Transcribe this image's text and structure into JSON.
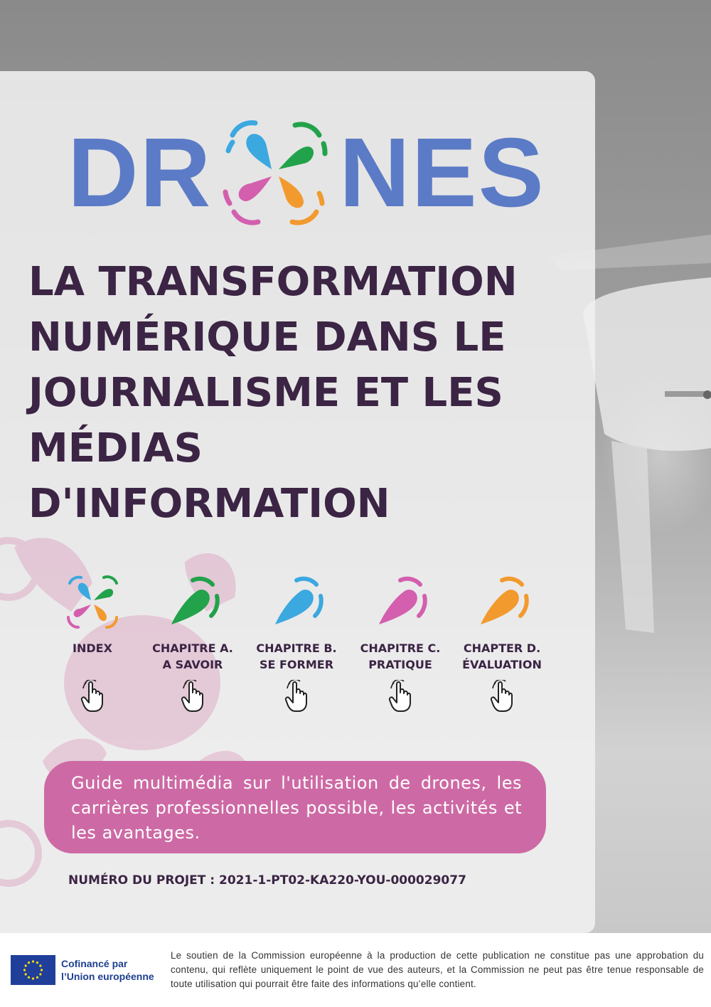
{
  "logo": {
    "left_text": "DR",
    "right_text": "NES",
    "colors": {
      "text": "#5b7bc6",
      "blue": "#3ba8e0",
      "green": "#22a24a",
      "pink": "#d35fae",
      "orange": "#f29a2e"
    }
  },
  "title_lines": [
    "LA TRANSFORMATION",
    "NUMÉRIQUE DANS LE",
    "JOURNALISME ET LES",
    "MÉDIAS",
    "D'INFORMATION"
  ],
  "nav": [
    {
      "icon": "drones-logo-icon",
      "line1": "INDEX",
      "line2": ""
    },
    {
      "icon": "green-drone-icon",
      "color": "#22a24a",
      "line1": "CHAPITRE A.",
      "line2": "A SAVOIR"
    },
    {
      "icon": "blue-drone-icon",
      "color": "#3ba8e0",
      "line1": "CHAPITRE B.",
      "line2": "SE FORMER"
    },
    {
      "icon": "pink-drone-icon",
      "color": "#d35fae",
      "line1": "CHAPITRE C.",
      "line2": "PRATIQUE"
    },
    {
      "icon": "orange-drone-icon",
      "color": "#f29a2e",
      "line1": "CHAPTER D.",
      "line2": "ÉVALUATION"
    }
  ],
  "description": "Guide multimédia sur l'utilisation de drones, les carrières professionnelles possible, les activités et les avantages.",
  "project_number": "NUMÉRO DU PROJET : 2021-1-PT02-KA220-YOU-000029077",
  "footer": {
    "cofinance_line1": "Cofinancé par",
    "cofinance_line2": "l’Union européenne",
    "disclaimer": "Le soutien de la Commission européenne à la production de cette publication ne constitue pas une approbation du contenu, qui reflète uniquement le point de vue des auteurs, et la Commission ne peut pas être tenue responsable de toute utilisation qui pourrait être faite des informations qu’elle contient."
  }
}
